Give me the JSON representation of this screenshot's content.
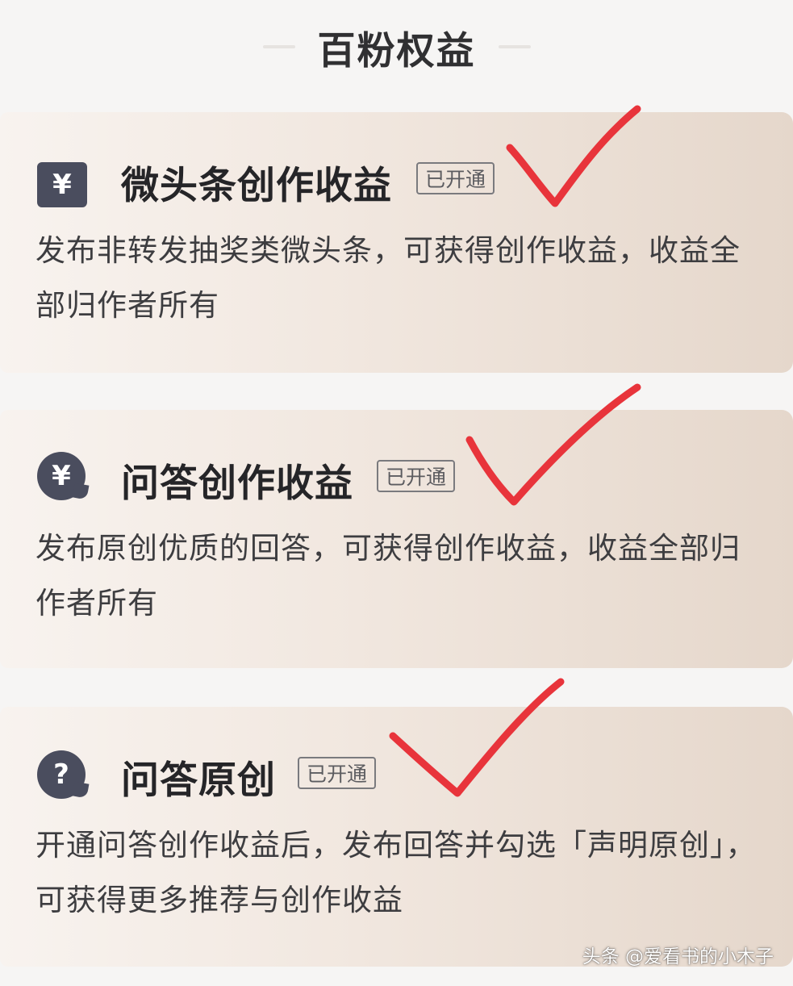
{
  "header": {
    "title": "百粉权益"
  },
  "cards": [
    {
      "icon": "yuan-square-icon",
      "icon_glyph": "¥",
      "title": "微头条创作收益",
      "badge": "已开通",
      "description": "发布非转发抽奖类微头条，可获得创作收益，收益全部归作者所有"
    },
    {
      "icon": "yuan-chat-bubble-icon",
      "icon_glyph": "¥",
      "title": "问答创作收益",
      "badge": "已开通",
      "description": "发布原创优质的回答，可获得创作收益，收益全部归作者所有"
    },
    {
      "icon": "question-chat-bubble-icon",
      "icon_glyph": "?",
      "title": "问答原创",
      "badge": "已开通",
      "description": "开通问答创作收益后，发布回答并勾选「声明原创」，可获得更多推荐与创作收益"
    }
  ],
  "annotations": {
    "checkmark_color": "#e8343b"
  },
  "watermark": "头条 @爱看书的小木子",
  "colors": {
    "page_background": "#f6f5f4",
    "card_gradient_start": "#f8f3ef",
    "card_gradient_end": "#e5d7cb",
    "icon_background": "#4a4d5e"
  }
}
